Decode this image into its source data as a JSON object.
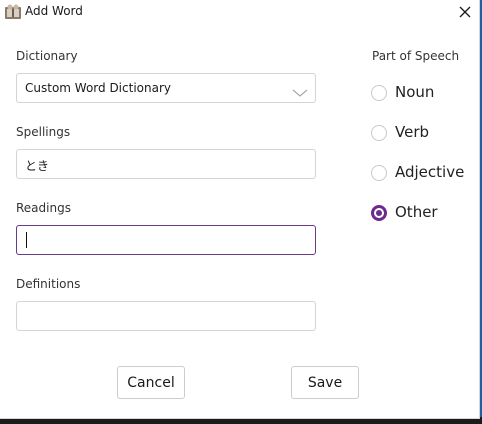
{
  "window": {
    "title": "Add Word",
    "app_icon": "dictionary-app-icon",
    "close_icon": "close-icon"
  },
  "form": {
    "dictionary": {
      "label": "Dictionary",
      "value": "Custom Word Dictionary",
      "chevron_icon": "chevron-down-icon"
    },
    "spellings": {
      "label": "Spellings",
      "value": "とき"
    },
    "readings": {
      "label": "Readings",
      "value": ""
    },
    "definitions": {
      "label": "Definitions",
      "value": ""
    }
  },
  "part_of_speech": {
    "label": "Part of Speech",
    "options": [
      {
        "label": "Noun",
        "selected": false
      },
      {
        "label": "Verb",
        "selected": false
      },
      {
        "label": "Adjective",
        "selected": false
      },
      {
        "label": "Other",
        "selected": true
      }
    ]
  },
  "buttons": {
    "cancel": "Cancel",
    "save": "Save"
  },
  "colors": {
    "accent": "#6b2a8f",
    "focus_border": "#6b3a8a",
    "field_border": "#d4d4d4"
  }
}
